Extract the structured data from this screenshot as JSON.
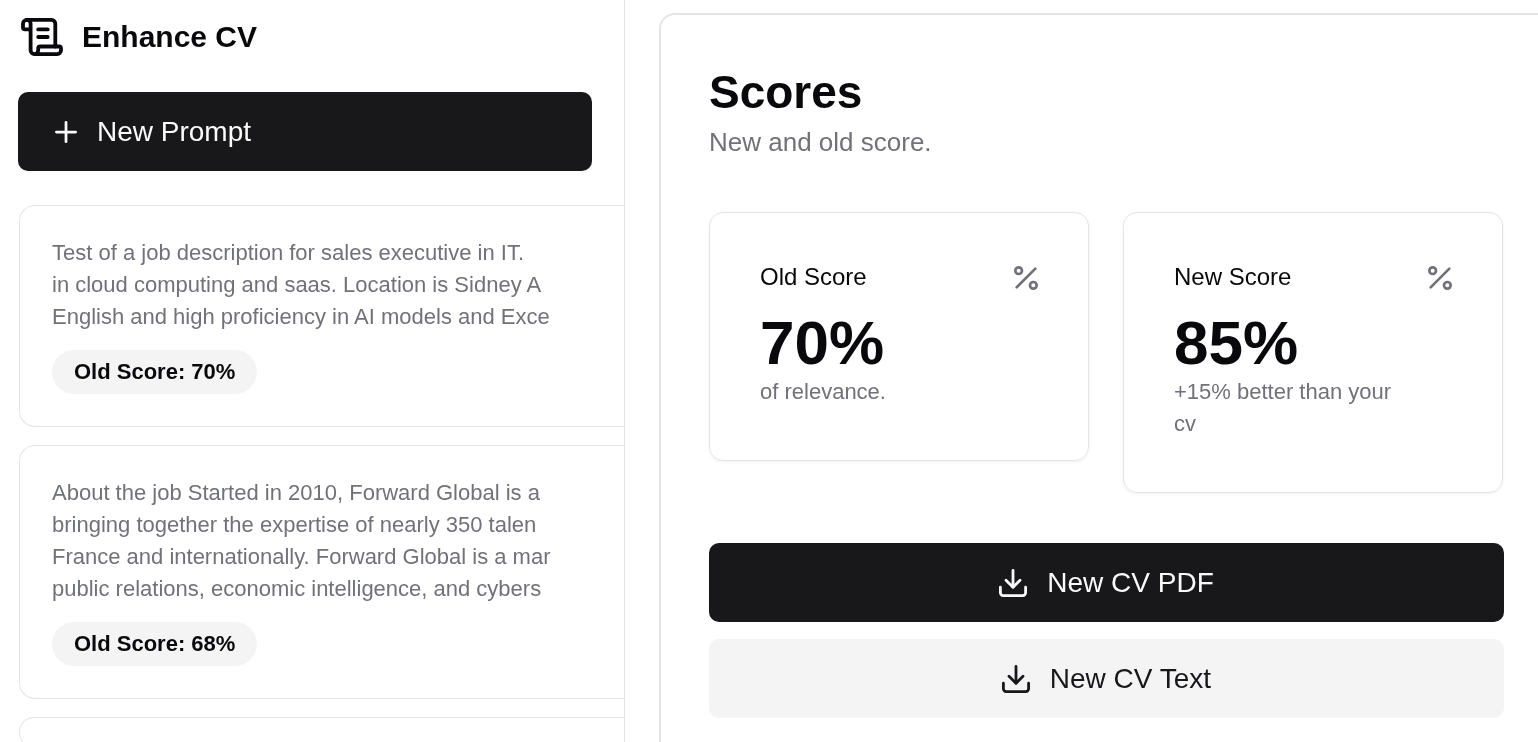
{
  "sidebar": {
    "title": "Enhance CV",
    "new_prompt_button": "New Prompt",
    "prompts": [
      {
        "lines": [
          "Test of a job description for sales executive in IT.",
          "in cloud computing and saas. Location is Sidney A",
          "English and high proficiency in AI models and Exce"
        ],
        "badge": "Old Score: 70%"
      },
      {
        "lines": [
          "About the job Started in 2010, Forward Global is a",
          "bringing together the expertise of nearly 350 talen",
          "France and internationally. Forward Global is a mar",
          "public relations, economic intelligence, and cybers"
        ],
        "badge": "Old Score: 68%"
      }
    ]
  },
  "scores": {
    "title": "Scores",
    "subtitle": "New and old score.",
    "cards": [
      {
        "label": "Old Score",
        "value": "70%",
        "note": "of relevance."
      },
      {
        "label": "New Score",
        "value": "85%",
        "note": "+15% better than your cv"
      }
    ],
    "buttons": [
      {
        "label": "New CV PDF",
        "kind": "primary"
      },
      {
        "label": "New CV Text",
        "kind": "secondary"
      }
    ]
  }
}
